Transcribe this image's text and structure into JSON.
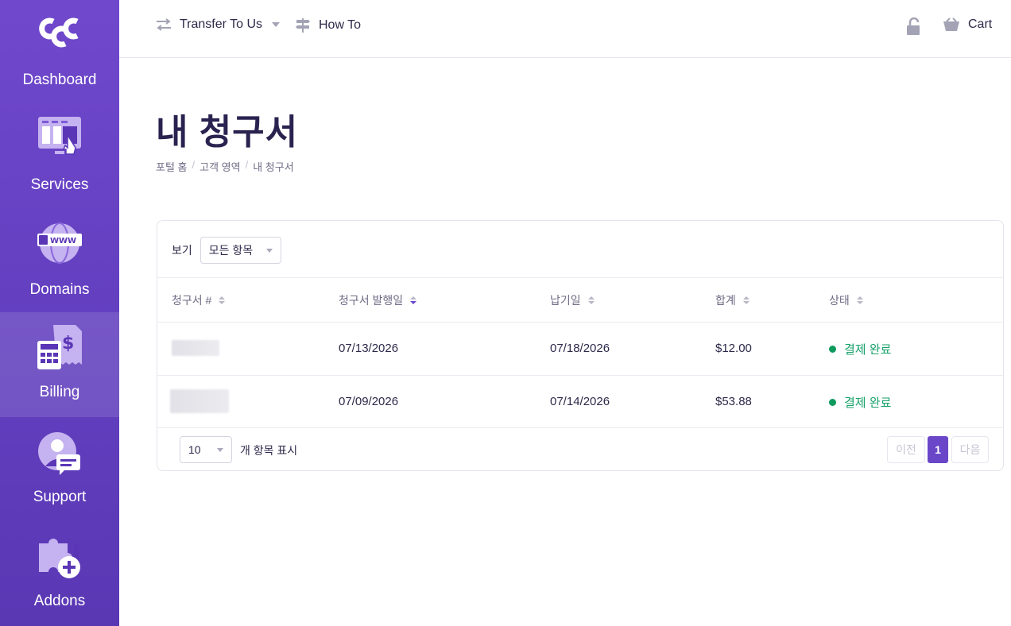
{
  "sidebar": {
    "logo_icon": "ccc-logo",
    "items": [
      {
        "label": "Dashboard",
        "icon": "dashboard-icon"
      },
      {
        "label": "Services",
        "icon": "services-icon"
      },
      {
        "label": "Domains",
        "icon": "domains-www-globe-icon"
      },
      {
        "label": "Billing",
        "icon": "billing-calculator-icon",
        "active": true
      },
      {
        "label": "Support",
        "icon": "support-agent-icon"
      },
      {
        "label": "Addons",
        "icon": "addons-puzzle-icon"
      }
    ]
  },
  "topbar": {
    "transfer_label": "Transfer To Us",
    "howto_label": "How To",
    "cart_label": "Cart"
  },
  "page": {
    "title": "내 청구서",
    "breadcrumb": [
      "포털 홈",
      "고객 영역",
      "내 청구서"
    ]
  },
  "table": {
    "filter_label": "보기",
    "filter_value": "모든 항목",
    "columns": [
      "청구서 #",
      "청구서 발행일",
      "납기일",
      "합계",
      "상태"
    ],
    "rows": [
      {
        "invoice": "",
        "issued": "07/13/2026",
        "due": "07/18/2026",
        "total": "$12.00",
        "status": "결제 완료"
      },
      {
        "invoice": "",
        "issued": "07/09/2026",
        "due": "07/14/2026",
        "total": "$53.88",
        "status": "결제 완료"
      }
    ],
    "page_size": "10",
    "page_size_label": "개 항목 표시",
    "pagination": {
      "prev": "이전",
      "current": "1",
      "next": "다음"
    }
  },
  "colors": {
    "sidebar": "#6a47c9",
    "accent": "#6a47c9",
    "paid_status": "#17a16a",
    "title": "#2a2350"
  }
}
